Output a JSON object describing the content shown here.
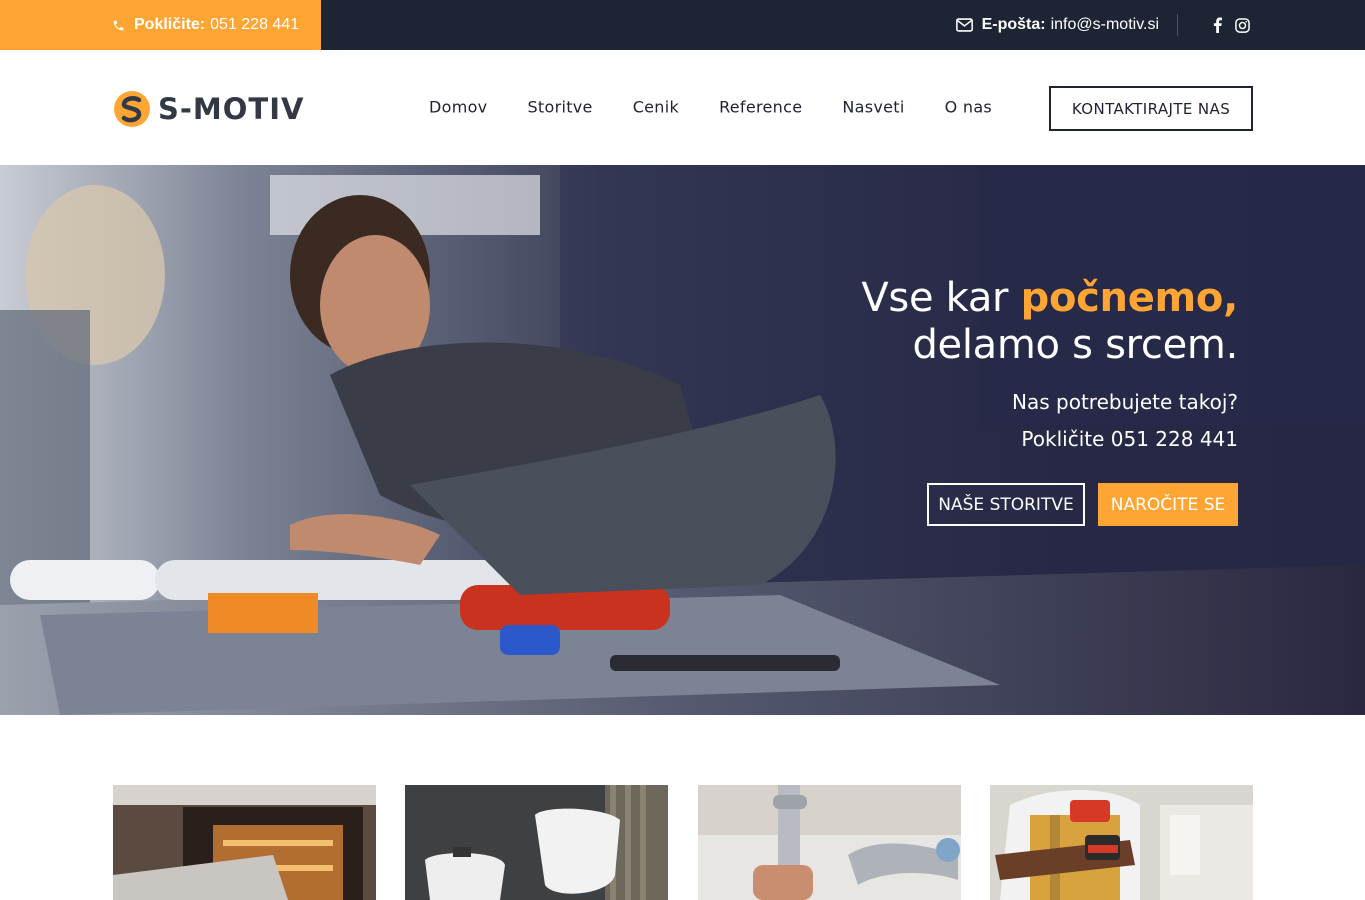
{
  "topbar": {
    "phone_label": "Pokličite:",
    "phone_value": "051 228 441",
    "email_label": "E-pošta:",
    "email_value": "info@s-motiv.si",
    "icons": [
      "phone-icon",
      "mail-icon",
      "facebook-icon",
      "instagram-icon"
    ]
  },
  "header": {
    "logo_text": "S-MOTIV",
    "nav": [
      "Domov",
      "Storitve",
      "Cenik",
      "Reference",
      "Nasveti",
      "O nas"
    ],
    "contact_button": "KONTAKTIRAJTE NAS"
  },
  "hero": {
    "title_part1": "Vse kar ",
    "title_accent": "počnemo,",
    "title_line2": "delamo s srcem.",
    "subtitle": "Nas potrebujete takoj?",
    "phone_line": "Pokličite 051 228 441",
    "button_services": "NAŠE STORITVE",
    "button_order": "NAROČITE SE"
  },
  "services": {
    "cards": [
      "oven-image",
      "bathroom-image",
      "plumbing-image",
      "handyman-image"
    ]
  },
  "colors": {
    "accent": "#ffa534",
    "dark": "#1d2433"
  }
}
